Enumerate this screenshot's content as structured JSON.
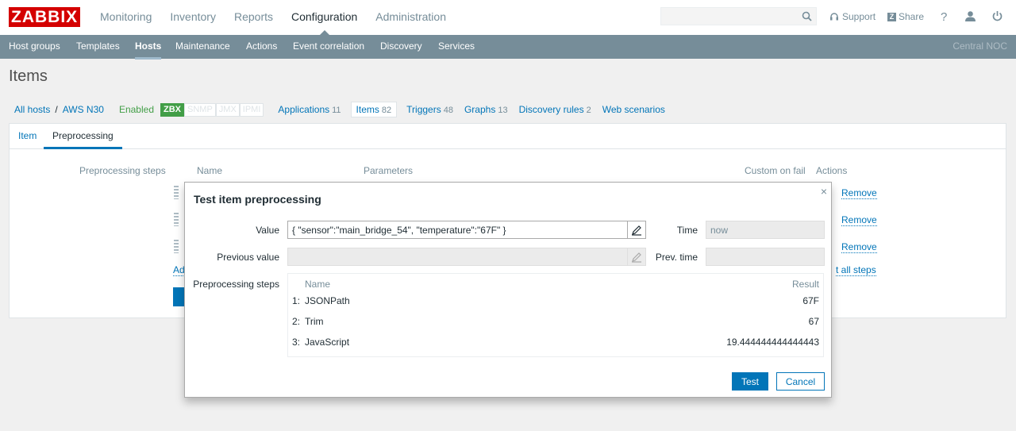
{
  "header": {
    "logo": "ZABBIX",
    "nav": [
      "Monitoring",
      "Inventory",
      "Reports",
      "Configuration",
      "Administration"
    ],
    "active_nav": "Configuration",
    "search_placeholder": "",
    "support_label": "Support",
    "share_label": "Share",
    "icons": [
      "search-icon",
      "support-headset-icon",
      "share-icon",
      "help-icon",
      "user-icon",
      "power-icon"
    ]
  },
  "subnav": {
    "items": [
      "Host groups",
      "Templates",
      "Hosts",
      "Maintenance",
      "Actions",
      "Event correlation",
      "Discovery",
      "Services"
    ],
    "active": "Hosts",
    "right_label": "Central NOC"
  },
  "page": {
    "title": "Items"
  },
  "breadcrumb": {
    "all_hosts": "All hosts",
    "separator": "/",
    "host": "AWS N30",
    "status": "Enabled",
    "availability": [
      "ZBX",
      "SNMP",
      "JMX",
      "IPMI"
    ],
    "tabs": [
      {
        "label": "Applications",
        "count": "11"
      },
      {
        "label": "Items",
        "count": "82"
      },
      {
        "label": "Triggers",
        "count": "48"
      },
      {
        "label": "Graphs",
        "count": "13"
      },
      {
        "label": "Discovery rules",
        "count": "2"
      },
      {
        "label": "Web scenarios",
        "count": ""
      }
    ]
  },
  "form": {
    "tabs": [
      "Item",
      "Preprocessing"
    ],
    "active_tab": "Preprocessing",
    "steps_label": "Preprocessing steps",
    "columns": {
      "name": "Name",
      "parameters": "Parameters",
      "custom_on_fail": "Custom on fail",
      "actions": "Actions"
    },
    "remove_label": "Remove",
    "add_partial": "Ad",
    "test_all_partial": "t all steps"
  },
  "modal": {
    "title": "Test item preprocessing",
    "value_label": "Value",
    "value": "{ \"sensor\":\"main_bridge_54\", \"temperature\":\"67F\" }",
    "time_label": "Time",
    "time_value": "now",
    "prev_value_label": "Previous value",
    "prev_value": "",
    "prev_time_label": "Prev. time",
    "prev_time": "",
    "steps_label": "Preprocessing steps",
    "steps_header_name": "Name",
    "steps_header_result": "Result",
    "steps": [
      {
        "num": "1:",
        "name": "JSONPath",
        "result": "67F"
      },
      {
        "num": "2:",
        "name": "Trim",
        "result": "67"
      },
      {
        "num": "3:",
        "name": "JavaScript",
        "result": "19.444444444444443"
      }
    ],
    "test_button": "Test",
    "cancel_button": "Cancel",
    "close_symbol": "×"
  }
}
